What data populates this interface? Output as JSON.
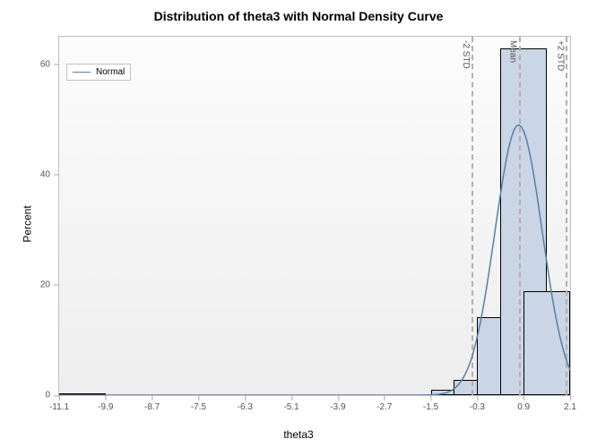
{
  "chart_data": {
    "type": "histogram+density",
    "title": "Distribution of theta3 with Normal Density Curve",
    "xlabel": "theta3",
    "ylabel": "Percent",
    "xlim": [
      -11.1,
      2.1
    ],
    "ylim": [
      0,
      65
    ],
    "x_ticks": [
      -11.1,
      -9.9,
      -8.7,
      -7.5,
      -6.3,
      -5.1,
      -3.9,
      -2.7,
      -1.5,
      -0.3,
      0.9,
      2.1
    ],
    "y_ticks": [
      0,
      20,
      40,
      60
    ],
    "bin_width": 1.2,
    "bars": [
      {
        "center": -10.5,
        "percent": 0.3
      },
      {
        "center": -0.9,
        "percent": 1.0
      },
      {
        "center": -0.3,
        "percent": 2.8
      },
      {
        "center": 0.3,
        "percent": 14.2
      },
      {
        "center": 0.9,
        "percent": 62.9
      },
      {
        "center": 1.5,
        "percent": 18.8
      }
    ],
    "references": [
      {
        "id": "minus2std",
        "label": "-2 STD",
        "x": -0.45
      },
      {
        "id": "mean",
        "label": "Mean",
        "x": 0.77
      },
      {
        "id": "plus2std",
        "label": "+2 STD",
        "x": 1.99
      }
    ],
    "density": {
      "name": "Normal",
      "mu": 0.77,
      "sigma": 0.61,
      "peak_percent": 49
    },
    "legend": {
      "items": [
        "Normal"
      ]
    }
  }
}
